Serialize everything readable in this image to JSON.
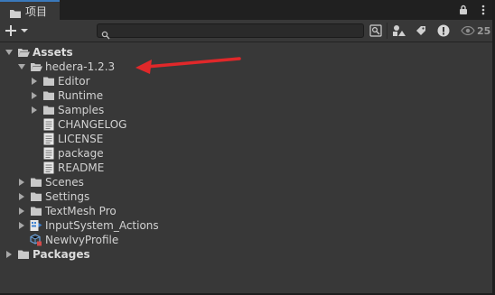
{
  "tab": {
    "label": "项目"
  },
  "toolbar": {
    "search_placeholder": "",
    "hidden_count": "25"
  },
  "tree": {
    "assets": "Assets",
    "hedera": "hedera-1.2.3",
    "editor": "Editor",
    "runtime": "Runtime",
    "samples": "Samples",
    "changelog": "CHANGELOG",
    "license": "LICENSE",
    "package": "package",
    "readme": "README",
    "scenes": "Scenes",
    "settings": "Settings",
    "textmesh": "TextMesh Pro",
    "inputsystem": "InputSystem_Actions",
    "ivyprofile": "NewIvyProfile",
    "packages": "Packages"
  },
  "colors": {
    "background": "#383838",
    "tab_accent": "#3a79bb",
    "annotation": "#e0282a"
  }
}
